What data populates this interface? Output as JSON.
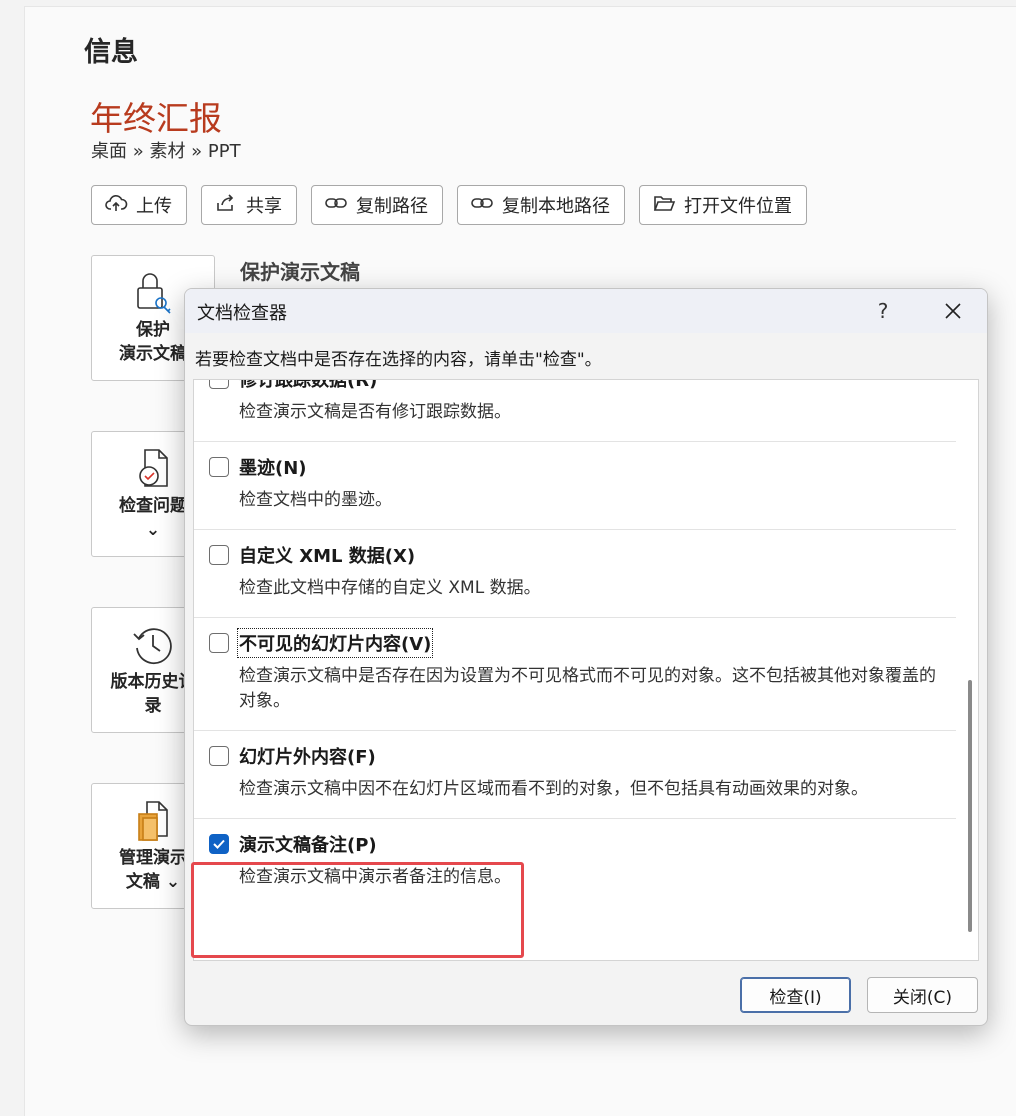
{
  "page": {
    "title": "信息"
  },
  "document": {
    "title": "年终汇报",
    "breadcrumb": "桌面 » 素材 » PPT"
  },
  "toolbar": [
    {
      "label": "上传",
      "icon": "upload-cloud-icon"
    },
    {
      "label": "共享",
      "icon": "share-icon"
    },
    {
      "label": "复制路径",
      "icon": "link-icon"
    },
    {
      "label": "复制本地路径",
      "icon": "link-icon"
    },
    {
      "label": "打开文件位置",
      "icon": "folder-open-icon"
    }
  ],
  "cards": [
    {
      "label": "保护\n演示文稿",
      "icon": "lock-key-icon"
    },
    {
      "label": "检查问题\n⌄",
      "icon": "inspect-document-icon"
    },
    {
      "label": "版本历史记\n录",
      "icon": "history-icon"
    },
    {
      "label": "管理演示\n文稿 ⌄",
      "icon": "manage-document-icon"
    }
  ],
  "section": {
    "protect_title": "保护演示文稿"
  },
  "dialog": {
    "title": "文档检查器",
    "help": "?",
    "instruction": "若要检查文档中是否存在选择的内容，请单击\"检查\"。",
    "items": [
      {
        "label": "修订跟踪数据(R)",
        "desc": "检查演示文稿是否有修订跟踪数据。",
        "checked": false
      },
      {
        "label": "墨迹(N)",
        "desc": "检查文档中的墨迹。",
        "checked": false
      },
      {
        "label": "自定义 XML 数据(X)",
        "desc": "检查此文档中存储的自定义 XML 数据。",
        "checked": false
      },
      {
        "label": "不可见的幻灯片内容(V)",
        "desc": "检查演示文稿中是否存在因为设置为不可见格式而不可见的对象。这不包括被其他对象覆盖的对象。",
        "checked": false
      },
      {
        "label": "幻灯片外内容(F)",
        "desc": "检查演示文稿中因不在幻灯片区域而看不到的对象，但不包括具有动画效果的对象。",
        "checked": false
      },
      {
        "label": "演示文稿备注(P)",
        "desc": "检查演示文稿中演示者备注的信息。",
        "checked": true
      }
    ],
    "inspect_button": "检查(I)",
    "close_button": "关闭(C)"
  },
  "colors": {
    "title_accent": "#b83b1e",
    "checkbox_checked": "#0f62c5",
    "highlight": "#e5484d"
  }
}
